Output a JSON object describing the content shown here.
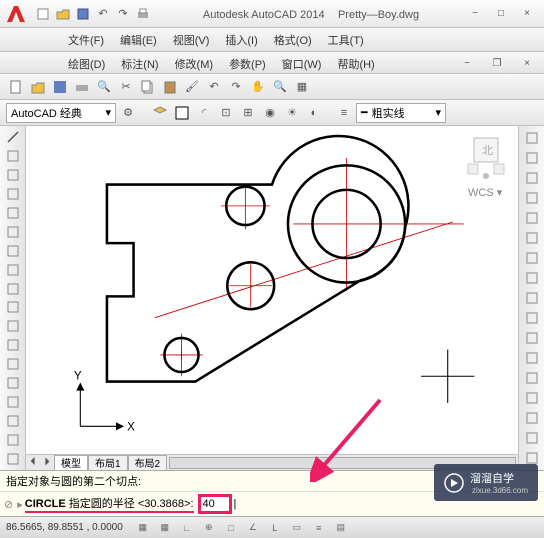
{
  "title": {
    "app": "Autodesk AutoCAD 2014",
    "file": "Pretty—Boy.dwg"
  },
  "menus": {
    "row1": [
      {
        "label": "文件(F)"
      },
      {
        "label": "编辑(E)"
      },
      {
        "label": "视图(V)"
      },
      {
        "label": "插入(I)"
      },
      {
        "label": "格式(O)"
      },
      {
        "label": "工具(T)"
      }
    ],
    "row2": [
      {
        "label": "绘图(D)"
      },
      {
        "label": "标注(N)"
      },
      {
        "label": "修改(M)"
      },
      {
        "label": "参数(P)"
      },
      {
        "label": "窗口(W)"
      },
      {
        "label": "帮助(H)"
      }
    ]
  },
  "workspace": {
    "label": "AutoCAD 经典"
  },
  "linetype": {
    "label": "粗实线"
  },
  "tabs": [
    {
      "label": "模型",
      "active": true
    },
    {
      "label": "布局1",
      "active": false
    },
    {
      "label": "布局2",
      "active": false
    }
  ],
  "command": {
    "history": "指定对象与圆的第二个切点:",
    "cmd": "CIRCLE",
    "prompt": "指定圆的半径",
    "default": "<30.3868>:",
    "input": "40"
  },
  "status": {
    "coords": "86.5665, 89.8551 , 0.0000"
  },
  "ucs": {
    "x": "X",
    "y": "Y"
  },
  "viewcube": {
    "wcs": "WCS",
    "north": "北"
  },
  "watermark": {
    "brand": "溜溜自学",
    "url": "zixue.3d66.com"
  },
  "icons": {
    "new": "new-icon",
    "open": "open-icon",
    "save": "save-icon",
    "undo": "undo-icon",
    "redo": "redo-icon",
    "print": "print-icon",
    "min": "−",
    "max": "□",
    "close": "×",
    "restore": "❐"
  },
  "left_tools": [
    "line-icon",
    "construction-line-icon",
    "polyline-icon",
    "polygon-icon",
    "rectangle-icon",
    "arc-icon",
    "circle-icon",
    "revision-cloud-icon",
    "spline-icon",
    "ellipse-icon",
    "ellipse-arc-icon",
    "block-icon",
    "point-icon",
    "hatch-icon",
    "region-icon",
    "table-icon",
    "text-icon",
    "add-icon"
  ],
  "right_tools": [
    "erase-icon",
    "copy-icon",
    "mirror-icon",
    "offset-icon",
    "array-icon",
    "move-icon",
    "rotate-icon",
    "scale-icon",
    "stretch-icon",
    "trim-icon",
    "extend-icon",
    "break-icon",
    "join-icon",
    "chamfer-icon",
    "fillet-icon",
    "explode-icon",
    "properties-icon"
  ]
}
